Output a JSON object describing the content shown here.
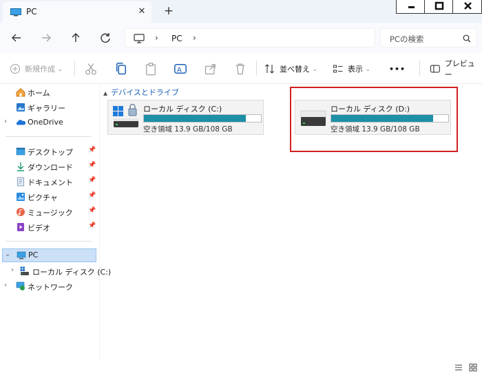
{
  "tab": {
    "title": "PC"
  },
  "address": {
    "crumb": "PC"
  },
  "search": {
    "placeholder": "PCの検索"
  },
  "commands": {
    "new": "新規作成",
    "sort": "並べ替え",
    "view": "表示",
    "more": "•••",
    "preview": "プレビュー"
  },
  "nav": {
    "home": "ホーム",
    "gallery": "ギャラリー",
    "onedrive": "OneDrive",
    "desktop": "デスクトップ",
    "downloads": "ダウンロード",
    "documents": "ドキュメント",
    "pictures": "ピクチャ",
    "music": "ミュージック",
    "videos": "ビデオ",
    "pc": "PC",
    "local_c": "ローカル ディスク (C:)",
    "network": "ネットワーク"
  },
  "group": {
    "title": "デバイスとドライブ"
  },
  "drives": [
    {
      "name": "ローカル ディスク (C:)",
      "free": "空き領域 13.9 GB/108 GB",
      "used_fraction": 0.87
    },
    {
      "name": "ローカル ディスク (D:)",
      "free": "空き領域 13.9 GB/108 GB",
      "used_fraction": 0.87
    }
  ],
  "colors": {
    "accent": "#1d8fa7",
    "highlight": "#d21f1f",
    "selection": "#cce0f7"
  }
}
